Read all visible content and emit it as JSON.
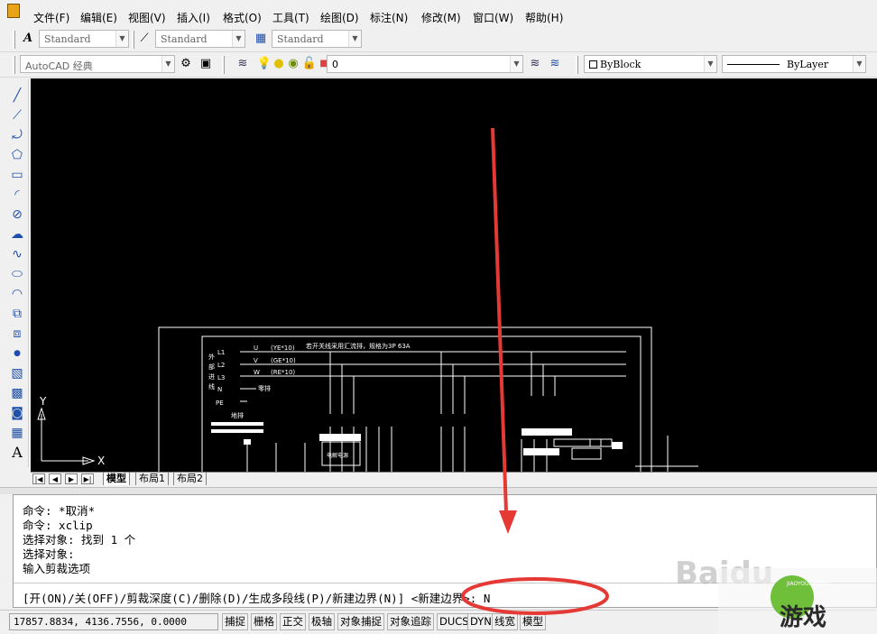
{
  "menu": [
    "文件(F)",
    "编辑(E)",
    "视图(V)",
    "插入(I)",
    "格式(O)",
    "工具(T)",
    "绘图(D)",
    "标注(N)",
    "修改(M)",
    "窗口(W)",
    "帮助(H)"
  ],
  "toolbar1": {
    "text_style": "Standard",
    "dim_style": "Standard",
    "table_style": "Standard"
  },
  "toolbar2": {
    "workspace": "AutoCAD 经典",
    "layer": "0",
    "color": "ByBlock",
    "linetype": "ByLayer"
  },
  "canvas": {
    "ucs_x": "X",
    "ucs_y": "Y",
    "drawing": {
      "title_note": "若开关线采用汇流排，规格为3P 63A",
      "phase_labels": [
        "L1",
        "L2",
        "L3",
        "N",
        "PE"
      ],
      "side_labels": [
        "外",
        "部",
        "进",
        "线"
      ],
      "bus_labels": [
        "(YE*10)",
        "(GE*10)",
        "(RE*10)"
      ],
      "bus_letters": [
        "U",
        "V",
        "W"
      ],
      "zero_label": "零排",
      "ground_label": "地排",
      "box_label": "电解电源"
    }
  },
  "tabs": {
    "model": "模型",
    "layout1": "布局1",
    "layout2": "布局2"
  },
  "command_history": [
    "命令: *取消*",
    "命令: xclip",
    "选择对象: 找到 1 个",
    "选择对象:",
    "输入剪裁选项"
  ],
  "command_prompt": "[开(ON)/关(OFF)/剪裁深度(C)/删除(D)/生成多段线(P)/新建边界(N)] <新建边界>: N",
  "status": {
    "coords": "17857.8834, 4136.7556, 0.0000",
    "buttons": [
      "捕捉",
      "栅格",
      "正交",
      "极轴",
      "对象捕捉",
      "对象追踪",
      "DUCS",
      "DYN",
      "线宽",
      "模型"
    ]
  },
  "annotation_color": "#e53935",
  "watermark": {
    "baidu": "Baidu",
    "site": "游戏",
    "site_sub": "JIAOYOUXIWANG"
  }
}
